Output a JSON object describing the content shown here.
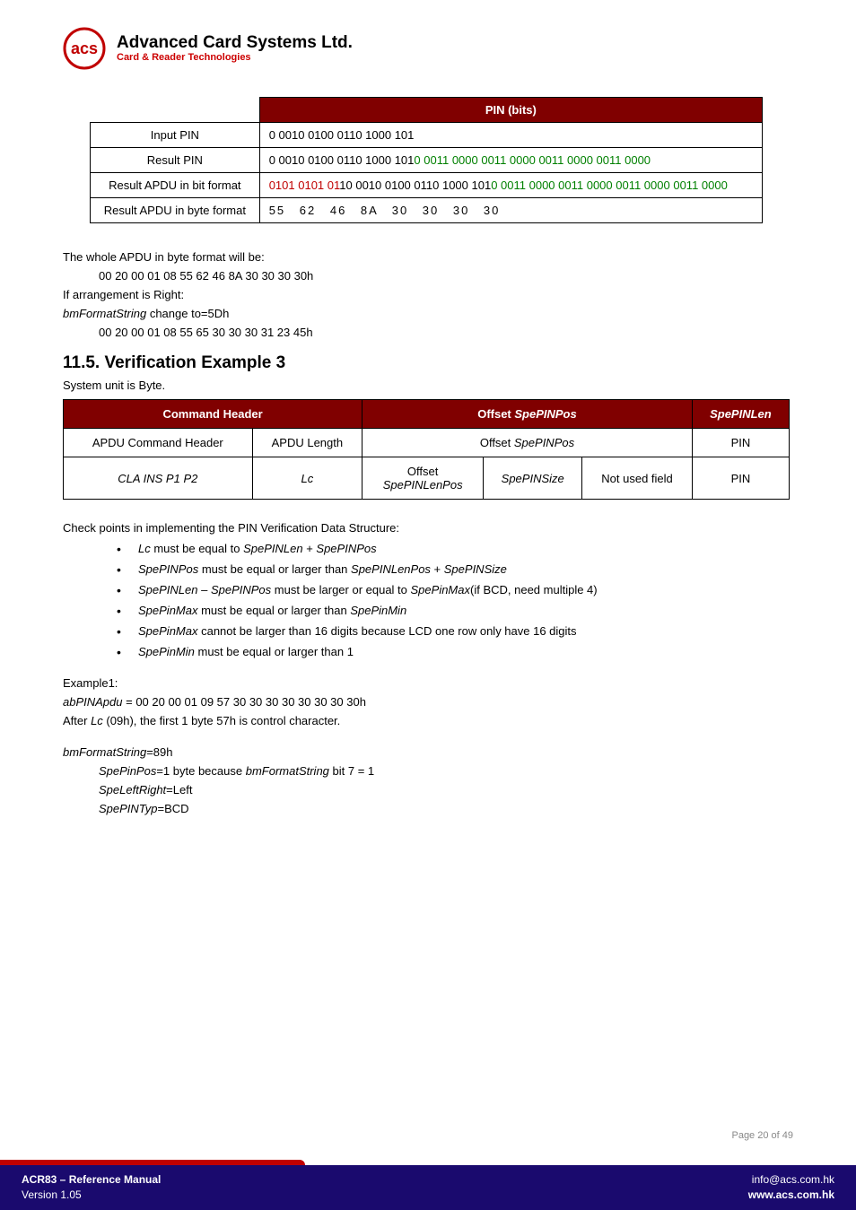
{
  "header": {
    "company": "Advanced Card Systems Ltd.",
    "tagline": "Card & Reader Technologies"
  },
  "table1": {
    "head": "PIN (bits)",
    "rows": [
      {
        "label": "Input PIN",
        "plain": "0 0010 0100 0110 1000 101"
      },
      {
        "label": "Result PIN",
        "black": "0 0010 0100 0110 1000 101",
        "green": "0 0011 0000 0011 0000 0011 0000 0011 0000"
      },
      {
        "label": "Result APDU in bit format",
        "red": "0101 0101 01",
        "black": "10 0010 0100 0110 1000 101",
        "green": "0 0011 0000 0011 0000 0011 0000 0011 0000"
      },
      {
        "label": "Result APDU in byte format",
        "bytes": "55   62   46  8A   30   30   30   30"
      }
    ]
  },
  "body1": {
    "p1": "The whole APDU in byte format will be:",
    "p1v": "00 20 00 01 08 55 62 46 8A 30 30 30 30h",
    "p2": "If arrangement is Right:",
    "p3a": "bmFormatString",
    "p3b": " change to=5Dh",
    "p3v": "00 20 00 01 08 55 65 30 30 30 31 23 45h"
  },
  "sectionTitle": "11.5. Verification Example 3",
  "sysunit": "System unit is Byte.",
  "table2": {
    "h1": "Command Header",
    "h2a": "Offset ",
    "h2b": "SpePINPos",
    "h3": "SpePINLen",
    "r1": {
      "c1": "APDU Command Header",
      "c2": "APDU Length",
      "c3a": "Offset ",
      "c3b": "SpePINPos",
      "c4": "PIN"
    },
    "r2": {
      "c1": "CLA INS P1 P2",
      "c2": "Lc",
      "c3a": "Offset",
      "c3b": "SpePINLenPos",
      "c4": "SpePINSize",
      "c5": "Not used field",
      "c6": "PIN"
    }
  },
  "checkLine": "Check points in implementing the PIN Verification Data Structure:",
  "bullets": [
    {
      "parts": [
        {
          "i": "Lc"
        },
        {
          "t": " must be equal to "
        },
        {
          "i": "SpePINLen"
        },
        {
          "t": " + "
        },
        {
          "i": "SpePINPos"
        }
      ]
    },
    {
      "parts": [
        {
          "i": "SpePINPos"
        },
        {
          "t": " must be equal or larger than "
        },
        {
          "i": "SpePINLenPos"
        },
        {
          "t": " + "
        },
        {
          "i": "SpePINSize"
        }
      ]
    },
    {
      "parts": [
        {
          "i": "SpePINLen – SpePINPos"
        },
        {
          "t": " must be larger or equal to "
        },
        {
          "i": "SpePinMax"
        },
        {
          "t": "(if BCD, need multiple 4)"
        }
      ]
    },
    {
      "parts": [
        {
          "i": "SpePinMax"
        },
        {
          "t": " must be equal or larger than "
        },
        {
          "i": "SpePinMin"
        }
      ]
    },
    {
      "parts": [
        {
          "i": "SpePinMax"
        },
        {
          "t": " cannot be larger than 16 digits because LCD one row only have 16 digits"
        }
      ]
    },
    {
      "parts": [
        {
          "i": "SpePinMin"
        },
        {
          "t": " must be equal or larger than 1"
        }
      ]
    }
  ],
  "example": {
    "title": "Example1:",
    "l1a": "abPINApdu",
    "l1b": " = 00 20 00 01 09 57 30 30 30 30 30 30 30 30h",
    "l2a": "After ",
    "l2b": "Lc",
    "l2c": " (09h), the first 1 byte 57h is control character.",
    "fsA": "bmFormatString",
    "fsB": "=89h",
    "s1a": "SpePinPos",
    "s1b": "=1 byte because ",
    "s1c": "bmFormatString",
    "s1d": " bit 7 = 1",
    "s2a": "SpeLeftRight",
    "s2b": "=Left",
    "s3a": "SpePINTyp",
    "s3b": "=BCD"
  },
  "pageNo": "Page 20 of 49",
  "footer": {
    "title": "ACR83 – Reference Manual",
    "version": "Version 1.05",
    "email": "info@acs.com.hk",
    "site": "www.acs.com.hk"
  }
}
